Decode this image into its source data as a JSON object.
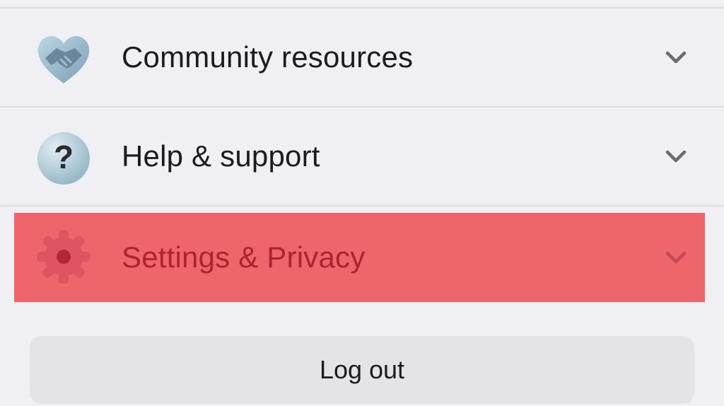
{
  "menu": {
    "items": [
      {
        "label": "Community resources",
        "icon": "handshake-icon",
        "expanded": false
      },
      {
        "label": "Help & support",
        "icon": "question-mark-icon",
        "expanded": false
      },
      {
        "label": "Settings & Privacy",
        "icon": "gear-icon",
        "expanded": false,
        "highlighted": true
      }
    ]
  },
  "logout": {
    "label": "Log out"
  },
  "colors": {
    "background": "#f0eff4",
    "highlight": "#ee666c",
    "highlight_text": "#b02230",
    "text": "#1c1c1e",
    "chevron": "#6b6b70",
    "button": "#e4e3e8"
  }
}
